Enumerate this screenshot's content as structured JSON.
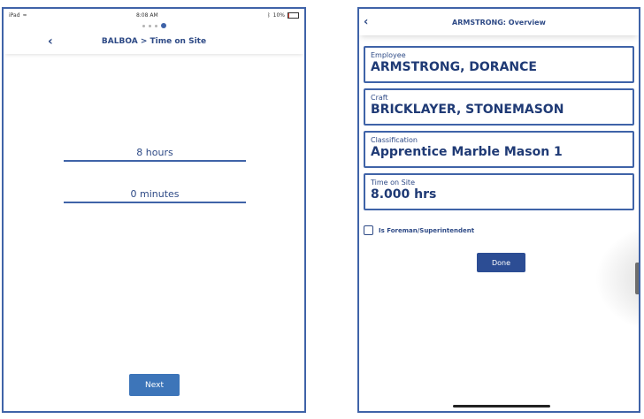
{
  "left_screen": {
    "status": {
      "device": "iPad",
      "time": "8:08 AM",
      "battery": "10%"
    },
    "page_dots": {
      "count": 4,
      "active_index": 3
    },
    "header": {
      "title": "BALBOA > Time on Site"
    },
    "hours": "8 hours",
    "minutes": "0 minutes",
    "next_label": "Next"
  },
  "right_screen": {
    "header": {
      "title": "ARMSTRONG: Overview"
    },
    "fields": [
      {
        "label": "Employee",
        "value": "ARMSTRONG, DORANCE"
      },
      {
        "label": "Craft",
        "value": "BRICKLAYER, STONEMASON"
      },
      {
        "label": "Classification",
        "value": "Apprentice Marble Mason 1"
      },
      {
        "label": "Time on Site",
        "value": "8.000 hrs"
      }
    ],
    "foreman_label": "Is Foreman/Superintendent",
    "foreman_checked": false,
    "done_label": "Done"
  },
  "colors": {
    "primary": "#3f63a8",
    "text": "#2e4a86",
    "next_button": "#3d75b9",
    "done_button": "#2c4d94"
  }
}
